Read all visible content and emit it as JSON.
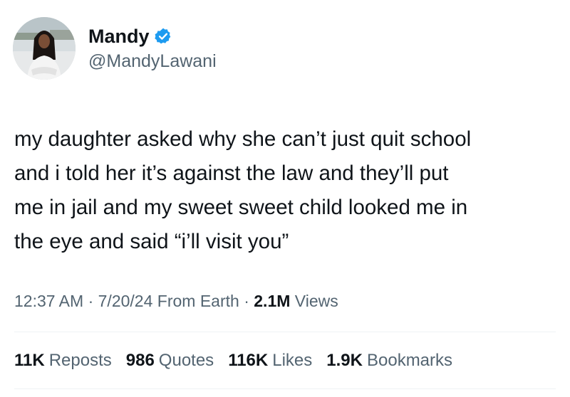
{
  "author": {
    "display_name": "Mandy",
    "handle": "@MandyLawani",
    "verified_color": "#1d9bf0",
    "avatar_icon": "profile-photo"
  },
  "tweet": {
    "lines": [
      "my daughter asked why she can’t just quit school",
      "and i told her it’s against the law and they’ll put",
      "me in jail and my sweet sweet child looked me in",
      "the eye and said “i’ll visit you”"
    ]
  },
  "meta": {
    "time": "12:37 AM",
    "date": "7/20/24",
    "source": "From Earth",
    "views_count": "2.1M",
    "views_label": "Views",
    "separator": "·"
  },
  "stats": {
    "reposts": {
      "count": "11K",
      "label": "Reposts"
    },
    "quotes": {
      "count": "986",
      "label": "Quotes"
    },
    "likes": {
      "count": "116K",
      "label": "Likes"
    },
    "bookmarks": {
      "count": "1.9K",
      "label": "Bookmarks"
    }
  },
  "colors": {
    "text_primary": "#0f1419",
    "text_secondary": "#536471",
    "divider": "#eff3f4"
  }
}
